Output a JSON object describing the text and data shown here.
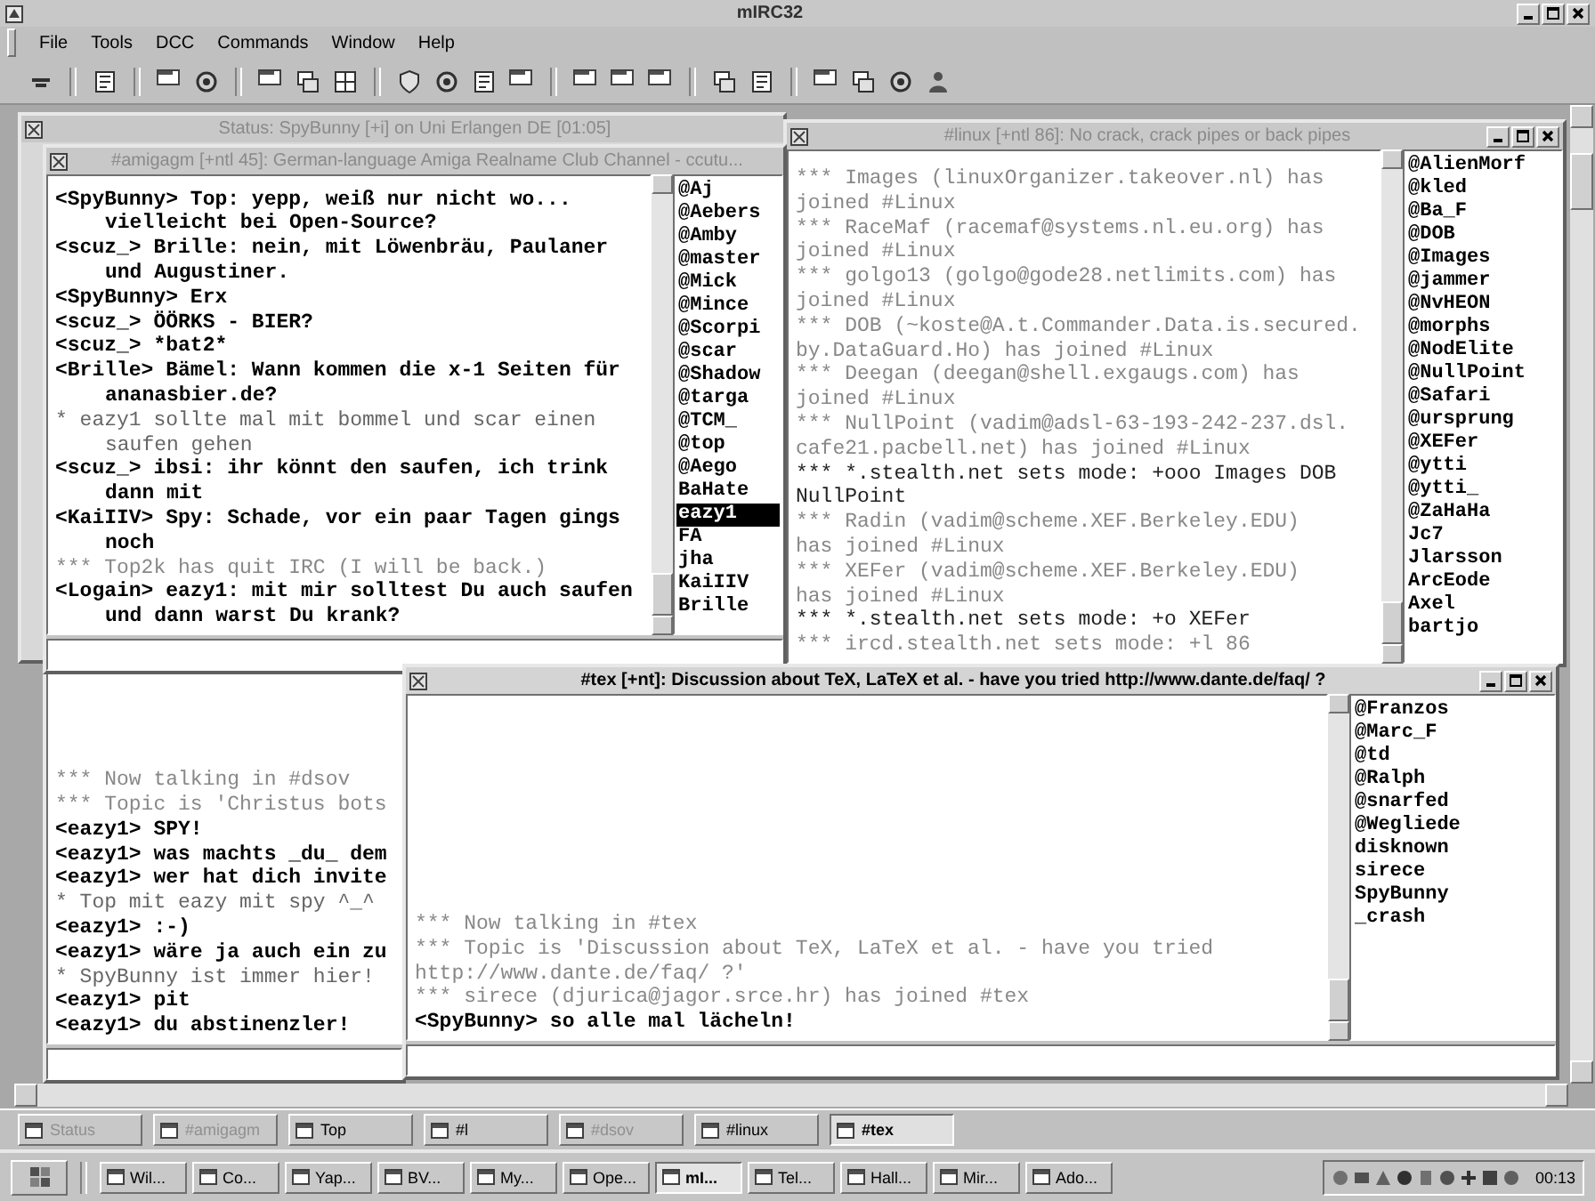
{
  "app": {
    "title": "mIRC32"
  },
  "menu": [
    "File",
    "Tools",
    "DCC",
    "Commands",
    "Window",
    "Help"
  ],
  "windows": [
    {
      "kind": "status",
      "title": "Status: SpyBunny [+i] on Uni Erlangen DE [01:05]",
      "active": false,
      "controls": false
    },
    {
      "kind": "channel",
      "title": "#amigagm [+ntl 45]: German-language Amiga Realname Club Channel - ccutu...",
      "active": false,
      "controls": false,
      "indent_wrapped": true,
      "lines": [
        {
          "kind": "msg",
          "text": [
            "<SpyBunny> Top: yepp, weiß nur nicht wo...",
            "vielleicht bei Open-Source?"
          ]
        },
        {
          "kind": "msg",
          "text": [
            "<scuz_> Brille: nein, mit Löwenbräu, Paulaner",
            "und Augustiner."
          ]
        },
        {
          "kind": "msg",
          "text": [
            "<SpyBunny> Erx"
          ]
        },
        {
          "kind": "msg",
          "text": [
            "<scuz_> ÖÖRKS - BIER?"
          ]
        },
        {
          "kind": "msg",
          "text": [
            "<scuz_> *bat2*"
          ]
        },
        {
          "kind": "msg",
          "text": [
            "<Brille> Bämel: Wann kommen die x-1 Seiten für",
            "ananasbier.de?"
          ]
        },
        {
          "kind": "action",
          "text": [
            "* eazy1 sollte mal mit bommel und scar einen",
            "saufen gehen"
          ]
        },
        {
          "kind": "msg",
          "text": [
            "<scuz_> ibsi: ihr könnt den saufen, ich trink",
            "dann mit"
          ]
        },
        {
          "kind": "msg",
          "text": [
            "<KaiIIV> Spy: Schade, vor ein paar Tagen gings",
            "noch"
          ]
        },
        {
          "kind": "event",
          "text": [
            "*** Top2k has quit IRC (I will be back.)"
          ]
        },
        {
          "kind": "msg",
          "text": [
            "<Logain> eazy1: mit mir solltest Du auch saufen",
            "und dann warst Du krank?"
          ]
        }
      ],
      "nicks": [
        {
          "nick": "@Aj",
          "selected": false
        },
        {
          "nick": "@Aebers",
          "selected": false
        },
        {
          "nick": "@Amby",
          "selected": false
        },
        {
          "nick": "@master",
          "selected": false
        },
        {
          "nick": "@Mick",
          "selected": false
        },
        {
          "nick": "@Mince",
          "selected": false
        },
        {
          "nick": "@Scorpi",
          "selected": false
        },
        {
          "nick": "@scar",
          "selected": false
        },
        {
          "nick": "@Shadow",
          "selected": false
        },
        {
          "nick": "@targa",
          "selected": false
        },
        {
          "nick": "@TCM_",
          "selected": false
        },
        {
          "nick": "@top",
          "selected": false
        },
        {
          "nick": "@Aego",
          "selected": false
        },
        {
          "nick": "BaHate",
          "selected": false
        },
        {
          "nick": "eazy1",
          "selected": true
        },
        {
          "nick": "FA",
          "selected": false
        },
        {
          "nick": "jha",
          "selected": false
        },
        {
          "nick": "KaiIIV",
          "selected": false
        },
        {
          "nick": "Brille",
          "selected": false
        }
      ]
    },
    {
      "kind": "channel",
      "title": "#linux [+ntl 86]: No crack, crack pipes or back pipes",
      "active": false,
      "controls": true,
      "indent_wrapped": false,
      "lines": [
        {
          "kind": "event",
          "text": [
            "*** Images (linuxOrganizer.takeover.nl) has",
            "joined #Linux"
          ]
        },
        {
          "kind": "event",
          "text": [
            "*** RaceMaf (racemaf@systems.nl.eu.org) has",
            "joined #Linux"
          ]
        },
        {
          "kind": "event",
          "text": [
            "*** golgo13 (golgo@gode28.netlimits.com) has",
            "joined #Linux"
          ]
        },
        {
          "kind": "event",
          "text": [
            "*** DOB (~koste@A.t.Commander.Data.is.secured.",
            "by.DataGuard.Ho) has joined #Linux"
          ]
        },
        {
          "kind": "event",
          "text": [
            "*** Deegan (deegan@shell.exgaugs.com) has",
            "joined #Linux"
          ]
        },
        {
          "kind": "event",
          "text": [
            "*** NullPoint (vadim@adsl-63-193-242-237.dsl.",
            "cafe21.pacbell.net) has joined #Linux"
          ]
        },
        {
          "kind": "mode",
          "text": [
            "*** *.stealth.net sets mode: +ooo Images DOB",
            "NullPoint"
          ]
        },
        {
          "kind": "event",
          "text": [
            "*** Radin (vadim@scheme.XEF.Berkeley.EDU)",
            "has joined #Linux"
          ]
        },
        {
          "kind": "event",
          "text": [
            "*** XEFer (vadim@scheme.XEF.Berkeley.EDU)",
            "has joined #Linux"
          ]
        },
        {
          "kind": "mode",
          "text": [
            "*** *.stealth.net sets mode: +o XEFer"
          ]
        },
        {
          "kind": "event",
          "text": [
            "*** ircd.stealth.net sets mode: +l 86"
          ]
        }
      ],
      "nicks": [
        {
          "nick": "@AlienMorf",
          "selected": false
        },
        {
          "nick": "@kled",
          "selected": false
        },
        {
          "nick": "@Ba_F",
          "selected": false
        },
        {
          "nick": "@DOB",
          "selected": false
        },
        {
          "nick": "@Images",
          "selected": false
        },
        {
          "nick": "@jammer",
          "selected": false
        },
        {
          "nick": "@NvHEON",
          "selected": false
        },
        {
          "nick": "@morphs",
          "selected": false
        },
        {
          "nick": "@NodElite",
          "selected": false
        },
        {
          "nick": "@NullPoint",
          "selected": false
        },
        {
          "nick": "@Safari",
          "selected": false
        },
        {
          "nick": "@ursprung",
          "selected": false
        },
        {
          "nick": "@XEFer",
          "selected": false
        },
        {
          "nick": "@ytti",
          "selected": false
        },
        {
          "nick": "@ytti_",
          "selected": false
        },
        {
          "nick": "@ZaHaHa",
          "selected": false
        },
        {
          "nick": "Jc7",
          "selected": false
        },
        {
          "nick": "Jlarsson",
          "selected": false
        },
        {
          "nick": "ArcEode",
          "selected": false
        },
        {
          "nick": "Axel",
          "selected": false
        },
        {
          "nick": "bartjo",
          "selected": false
        }
      ]
    },
    {
      "kind": "channel",
      "lines": [
        {
          "kind": "event",
          "text": [
            "*** Now talking in #dsov"
          ]
        },
        {
          "kind": "event",
          "text": [
            "*** Topic is 'Christus bots"
          ]
        },
        {
          "kind": "msg",
          "text": [
            "<eazy1> SPY!"
          ]
        },
        {
          "kind": "msg",
          "text": [
            "<eazy1> was machts _du_ dem"
          ]
        },
        {
          "kind": "msg",
          "text": [
            "<eazy1> wer hat dich invite"
          ]
        },
        {
          "kind": "action",
          "text": [
            "* Top mit eazy mit spy ^_^"
          ]
        },
        {
          "kind": "msg",
          "text": [
            "<eazy1> :-)"
          ]
        },
        {
          "kind": "msg",
          "text": [
            "<eazy1> wäre ja auch ein zu"
          ]
        },
        {
          "kind": "action",
          "text": [
            "* SpyBunny ist immer hier!"
          ]
        },
        {
          "kind": "msg",
          "text": [
            "<eazy1> pit"
          ]
        },
        {
          "kind": "msg",
          "text": [
            "<eazy1> du abstinenzler!"
          ]
        }
      ]
    },
    {
      "kind": "channel",
      "title": "#tex [+nt]: Discussion about TeX, LaTeX et al. - have you tried http://www.dante.de/faq/ ?",
      "active": true,
      "controls": true,
      "indent_wrapped": false,
      "lines": [
        {
          "kind": "event",
          "text": [
            "*** Now talking in #tex"
          ]
        },
        {
          "kind": "event",
          "text": [
            "*** Topic is 'Discussion about TeX, LaTeX et al. - have you tried",
            "http://www.dante.de/faq/ ?'"
          ]
        },
        {
          "kind": "event",
          "text": [
            "*** sirece (djurica@jagor.srce.hr) has joined #tex"
          ]
        },
        {
          "kind": "msg",
          "text": [
            "<SpyBunny> so alle mal lächeln!"
          ]
        }
      ],
      "nicks": [
        {
          "nick": "@Franzos",
          "selected": false
        },
        {
          "nick": "@Marc_F",
          "selected": false
        },
        {
          "nick": "@td",
          "selected": false
        },
        {
          "nick": "@Ralph",
          "selected": false
        },
        {
          "nick": "@snarfed",
          "selected": false
        },
        {
          "nick": "@Wegliede",
          "selected": false
        },
        {
          "nick": "disknown",
          "selected": false
        },
        {
          "nick": "sirece",
          "selected": false
        },
        {
          "nick": "SpyBunny",
          "selected": false
        },
        {
          "nick": "_crash",
          "selected": false
        }
      ]
    }
  ],
  "switchbar": [
    {
      "label": "Status",
      "selected": false,
      "dimmed": true
    },
    {
      "label": "#amigagm",
      "selected": false,
      "dimmed": true
    },
    {
      "label": "Top",
      "selected": false,
      "dimmed": false
    },
    {
      "label": "#l",
      "selected": false,
      "dimmed": false
    },
    {
      "label": "#dsov",
      "selected": false,
      "dimmed": true
    },
    {
      "label": "#linux",
      "selected": false,
      "dimmed": false
    },
    {
      "label": "#tex",
      "selected": true,
      "dimmed": false
    }
  ],
  "taskbar": {
    "tasks": [
      {
        "label": "Wil...",
        "selected": false
      },
      {
        "label": "Co...",
        "selected": false
      },
      {
        "label": "Yap...",
        "selected": false
      },
      {
        "label": "BV...",
        "selected": false
      },
      {
        "label": "My...",
        "selected": false
      },
      {
        "label": "Ope...",
        "selected": false
      },
      {
        "label": "mI...",
        "selected": true
      },
      {
        "label": "Tel...",
        "selected": false
      },
      {
        "label": "Hall...",
        "selected": false
      },
      {
        "label": "Mir...",
        "selected": false
      },
      {
        "label": "Ado...",
        "selected": false
      }
    ],
    "clock": "00:13"
  }
}
